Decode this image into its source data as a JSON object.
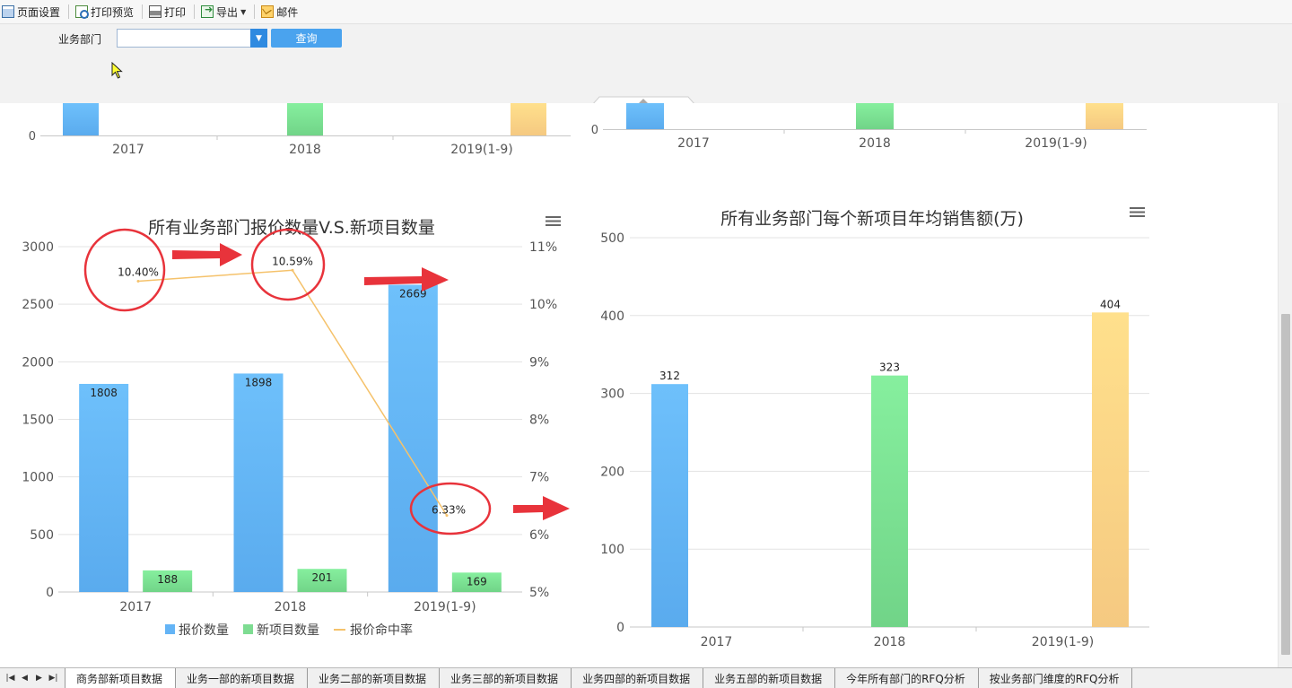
{
  "toolbar": {
    "page_setup": "页面设置",
    "print_preview": "打印预览",
    "print": "打印",
    "export": "导出",
    "mail": "邮件"
  },
  "filter": {
    "dept_label": "业务部门",
    "dept_value": "",
    "query_label": "查询"
  },
  "icons": {
    "page_setup": "page-setup-icon",
    "print_preview": "print-preview-icon",
    "print": "printer-icon",
    "export": "export-icon",
    "mail": "mail-icon",
    "dropdown": "chevron-down-icon",
    "menu": "hamburger-menu-icon",
    "cursor": "mouse-pointer-icon"
  },
  "colors": {
    "blue": "#64b4f6",
    "green": "#7edc92",
    "orange": "#f7cf84",
    "line": "#f5c26b",
    "arrow": "#e8333b",
    "accent": "#4aa3ee"
  },
  "chart_data": [
    {
      "id": "top_left_partial",
      "type": "bar",
      "categories": [
        "2017",
        "2018",
        "2019(1-9)"
      ],
      "y_ticks_visible": [
        "0"
      ]
    },
    {
      "id": "top_right_partial",
      "type": "bar",
      "categories": [
        "2017",
        "2018",
        "2019(1-9)"
      ],
      "y_ticks_visible": [
        "0"
      ]
    },
    {
      "id": "quote_vs_new_project",
      "type": "bar",
      "title": "所有业务部门报价数量V.S.新项目数量",
      "categories": [
        "2017",
        "2018",
        "2019(1-9)"
      ],
      "series": [
        {
          "name": "报价数量",
          "values": [
            1808,
            1898,
            2669
          ],
          "labels": [
            "1808",
            "1898",
            "2669"
          ],
          "color": "#64b4f6"
        },
        {
          "name": "新项目数量",
          "values": [
            188,
            201,
            169
          ],
          "labels": [
            "188",
            "201",
            "169"
          ],
          "color": "#7edc92"
        },
        {
          "name": "报价命中率",
          "type": "line",
          "axis": "right",
          "values": [
            10.4,
            10.59,
            6.33
          ],
          "labels": [
            "10.40%",
            "10.59%",
            "6.33%"
          ],
          "color": "#f5c26b"
        }
      ],
      "y_left": {
        "min": 0,
        "max": 3000,
        "ticks": [
          "0",
          "500",
          "1000",
          "1500",
          "2000",
          "2500",
          "3000"
        ]
      },
      "y_right": {
        "min": 5,
        "max": 11,
        "ticks": [
          "5%",
          "6%",
          "7%",
          "8%",
          "9%",
          "10%",
          "11%"
        ]
      },
      "legend": "bottom",
      "grid": true
    },
    {
      "id": "avg_sales_per_project",
      "type": "bar",
      "title": "所有业务部门每个新项目年均销售额(万)",
      "categories": [
        "2017",
        "2018",
        "2019(1-9)"
      ],
      "values": [
        312,
        323,
        404
      ],
      "labels": [
        "312",
        "323",
        "404"
      ],
      "colors": [
        "#64b4f6",
        "#7edc92",
        "#f7cf84"
      ],
      "y": {
        "min": 0,
        "max": 500,
        "ticks": [
          "0",
          "100",
          "200",
          "300",
          "400",
          "500"
        ]
      },
      "grid": true
    }
  ],
  "sheet_tabs": [
    {
      "label": "商务部新项目数据",
      "active": true
    },
    {
      "label": "业务一部的新项目数据",
      "active": false
    },
    {
      "label": "业务二部的新项目数据",
      "active": false
    },
    {
      "label": "业务三部的新项目数据",
      "active": false
    },
    {
      "label": "业务四部的新项目数据",
      "active": false
    },
    {
      "label": "业务五部的新项目数据",
      "active": false
    },
    {
      "label": "今年所有部门的RFQ分析",
      "active": false
    },
    {
      "label": "按业务部门维度的RFQ分析",
      "active": false
    }
  ]
}
